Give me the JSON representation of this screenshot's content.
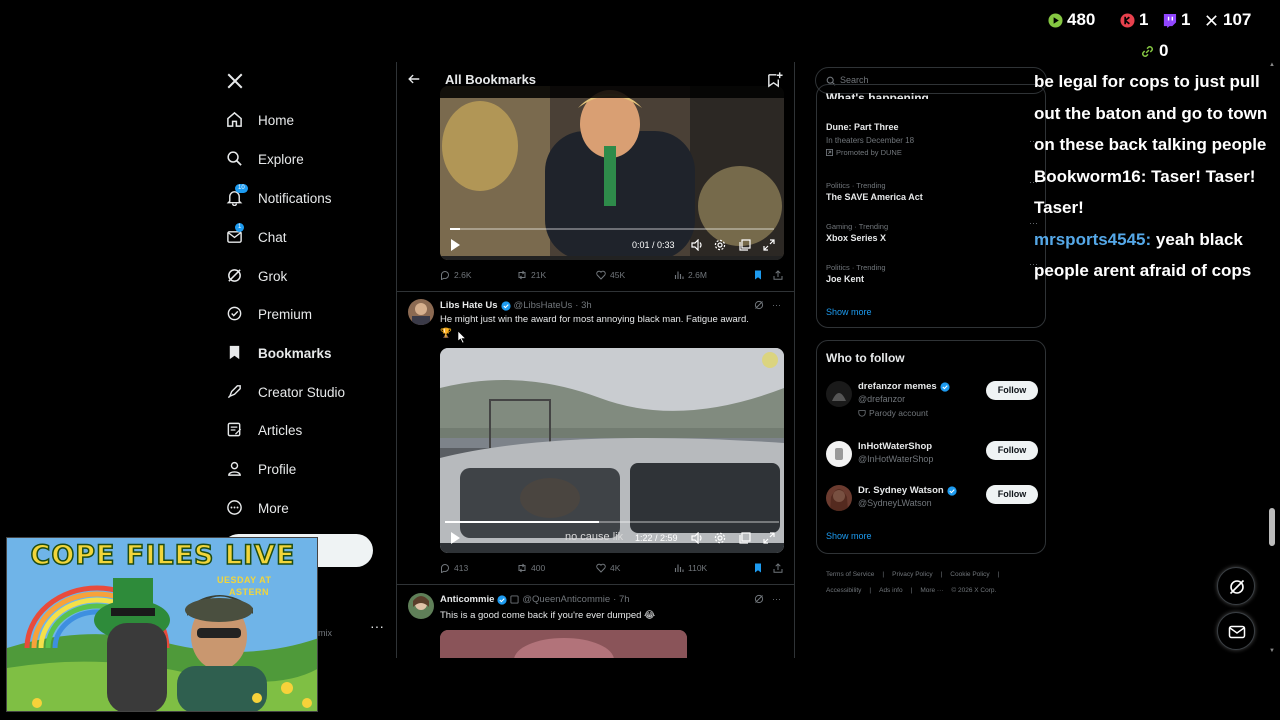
{
  "nav": {
    "items": [
      {
        "label": "Home",
        "icon": "home-icon"
      },
      {
        "label": "Explore",
        "icon": "search-icon"
      },
      {
        "label": "Notifications",
        "icon": "bell-icon",
        "badge": "10"
      },
      {
        "label": "Chat",
        "icon": "mail-icon",
        "badge": "1"
      },
      {
        "label": "Grok",
        "icon": "grok-icon"
      },
      {
        "label": "Premium",
        "icon": "premium-icon"
      },
      {
        "label": "Bookmarks",
        "icon": "bookmark-icon",
        "active": true
      },
      {
        "label": "Creator Studio",
        "icon": "rocket-icon"
      },
      {
        "label": "Articles",
        "icon": "articles-icon"
      },
      {
        "label": "Profile",
        "icon": "person-icon"
      },
      {
        "label": "More",
        "icon": "more-circle-icon"
      }
    ],
    "more_dots": "···",
    "partial_handle": "mix"
  },
  "main": {
    "title": "All Bookmarks",
    "posts": [
      {
        "video": {
          "time": "0:01 / 0:33",
          "progress": 0.03
        },
        "stats": {
          "replies": "2.6K",
          "reposts": "21K",
          "likes": "45K",
          "views": "2.6M"
        }
      },
      {
        "author": "Libs Hate Us",
        "handle": "@LibsHateUs",
        "age": "· 3h",
        "text": "He might just win the award for most annoying black man. Fatigue award.",
        "emoji": "🏆",
        "video": {
          "time": "1:22 / 2:59",
          "caption": "no cause lik",
          "progress": 0.46
        },
        "stats": {
          "replies": "413",
          "reposts": "400",
          "likes": "4K",
          "views": "110K"
        }
      },
      {
        "author": "Anticommie",
        "handle": "@QueenAnticommie",
        "age": "· 7h",
        "text": "This is a good come back if you're ever dumped 😂"
      }
    ],
    "more_dots": "···"
  },
  "right": {
    "search_placeholder": "Search",
    "trends_header": "What's happening",
    "trends": [
      {
        "category": "",
        "name": "Dune: Part Three",
        "sub": "In theaters December 18",
        "promo": "Promoted by DUNE"
      },
      {
        "category": "Politics · Trending",
        "name": "The SAVE America Act"
      },
      {
        "category": "Gaming · Trending",
        "name": "Xbox Series X"
      },
      {
        "category": "Politics · Trending",
        "name": "Joe Kent"
      }
    ],
    "show_more": "Show more",
    "who_to_follow": {
      "title": "Who to follow",
      "accounts": [
        {
          "name": "drefanzor memes",
          "handle": "@drefanzor",
          "tag": "Parody account",
          "button": "Follow"
        },
        {
          "name": "InHotWaterShop",
          "handle": "@InHotWaterShop",
          "button": "Follow"
        },
        {
          "name": "Dr. Sydney Watson",
          "handle": "@SydneyLWatson",
          "button": "Follow"
        }
      ],
      "show_more": "Show more"
    },
    "footer": [
      "Terms of Service",
      "|",
      "Privacy Policy",
      "|",
      "Cookie Policy",
      "|",
      "Accessibility",
      "|",
      "Ads info",
      "|",
      "More ···",
      "© 2026 X Corp."
    ]
  },
  "overlay": {
    "stats": [
      {
        "icon": "rumble-icon",
        "value": "480",
        "color": "#85c742"
      },
      {
        "icon": "kick-icon",
        "value": "1",
        "color": "#e8414d"
      },
      {
        "icon": "twitch-icon",
        "value": "1",
        "color": "#9146ff"
      },
      {
        "icon": "x-icon",
        "value": "107",
        "color": "#ffffff"
      },
      {
        "icon": "link-icon",
        "value": "0",
        "color": "#85c742"
      }
    ],
    "chat": {
      "line1": "be legal for cops to just pull out the baton and go to town on these back talking people",
      "line2_user": "Bookworm16:",
      "line2_text": "Taser! Taser! Taser!",
      "line3_user": "mrsports4545:",
      "line3_text": "yeah black people arent afraid of cops"
    },
    "webcam": {
      "title": "COPE FILES LIVE",
      "sub1": "UESDAY AT",
      "sub2": "ASTERN"
    }
  },
  "colors": {
    "accent": "#1d9bf0",
    "background": "#000000",
    "border": "#2f3336",
    "muted": "#71767b"
  }
}
